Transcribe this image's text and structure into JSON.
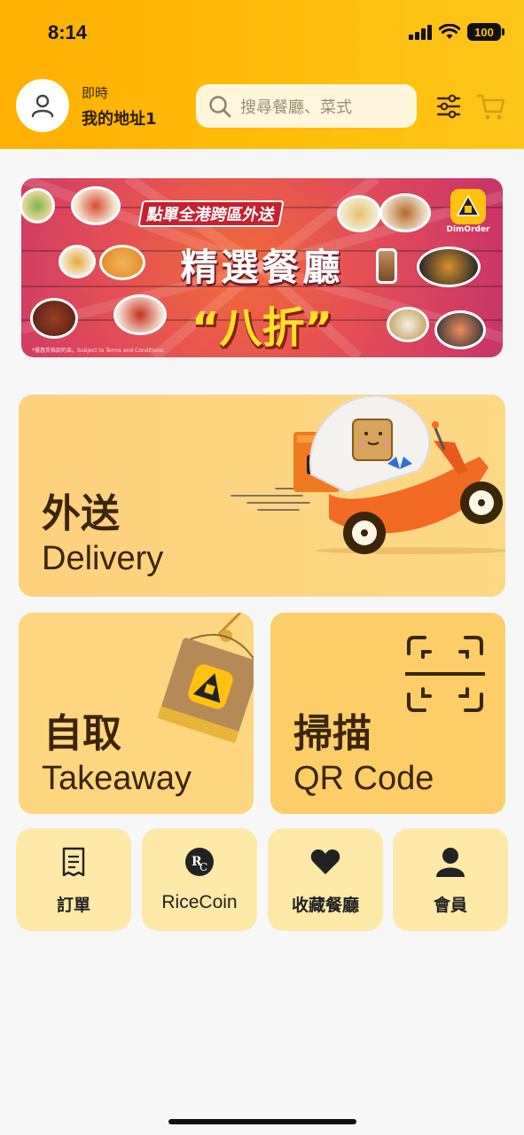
{
  "status_bar": {
    "time": "8:14",
    "battery": "100"
  },
  "header": {
    "address_mode": "即時",
    "address_name": "我的地址1",
    "search_placeholder": "搜尋餐廳、菜式"
  },
  "banner": {
    "tag": "點單全港跨區外送",
    "title": "精選餐廳",
    "discount": "“八折”",
    "logo_text": "DimOrder",
    "fine_print": "*優惠受條款約束。Subject to Terms and Conditions."
  },
  "cards": {
    "delivery": {
      "zh": "外送",
      "en": "Delivery"
    },
    "takeaway": {
      "zh": "自取",
      "en": "Takeaway"
    },
    "qr": {
      "zh": "掃描",
      "en": "QR Code"
    }
  },
  "shortcuts": [
    {
      "label": "訂單",
      "icon": "receipt-icon"
    },
    {
      "label": "RiceCoin",
      "icon": "ricecoin-icon"
    },
    {
      "label": "收藏餐廳",
      "icon": "heart-icon"
    },
    {
      "label": "會員",
      "icon": "member-icon"
    }
  ],
  "colors": {
    "brand": "#ffb800",
    "card": "#fdd67f",
    "tile": "#ffe9a9",
    "text_dark": "#3a2608"
  }
}
